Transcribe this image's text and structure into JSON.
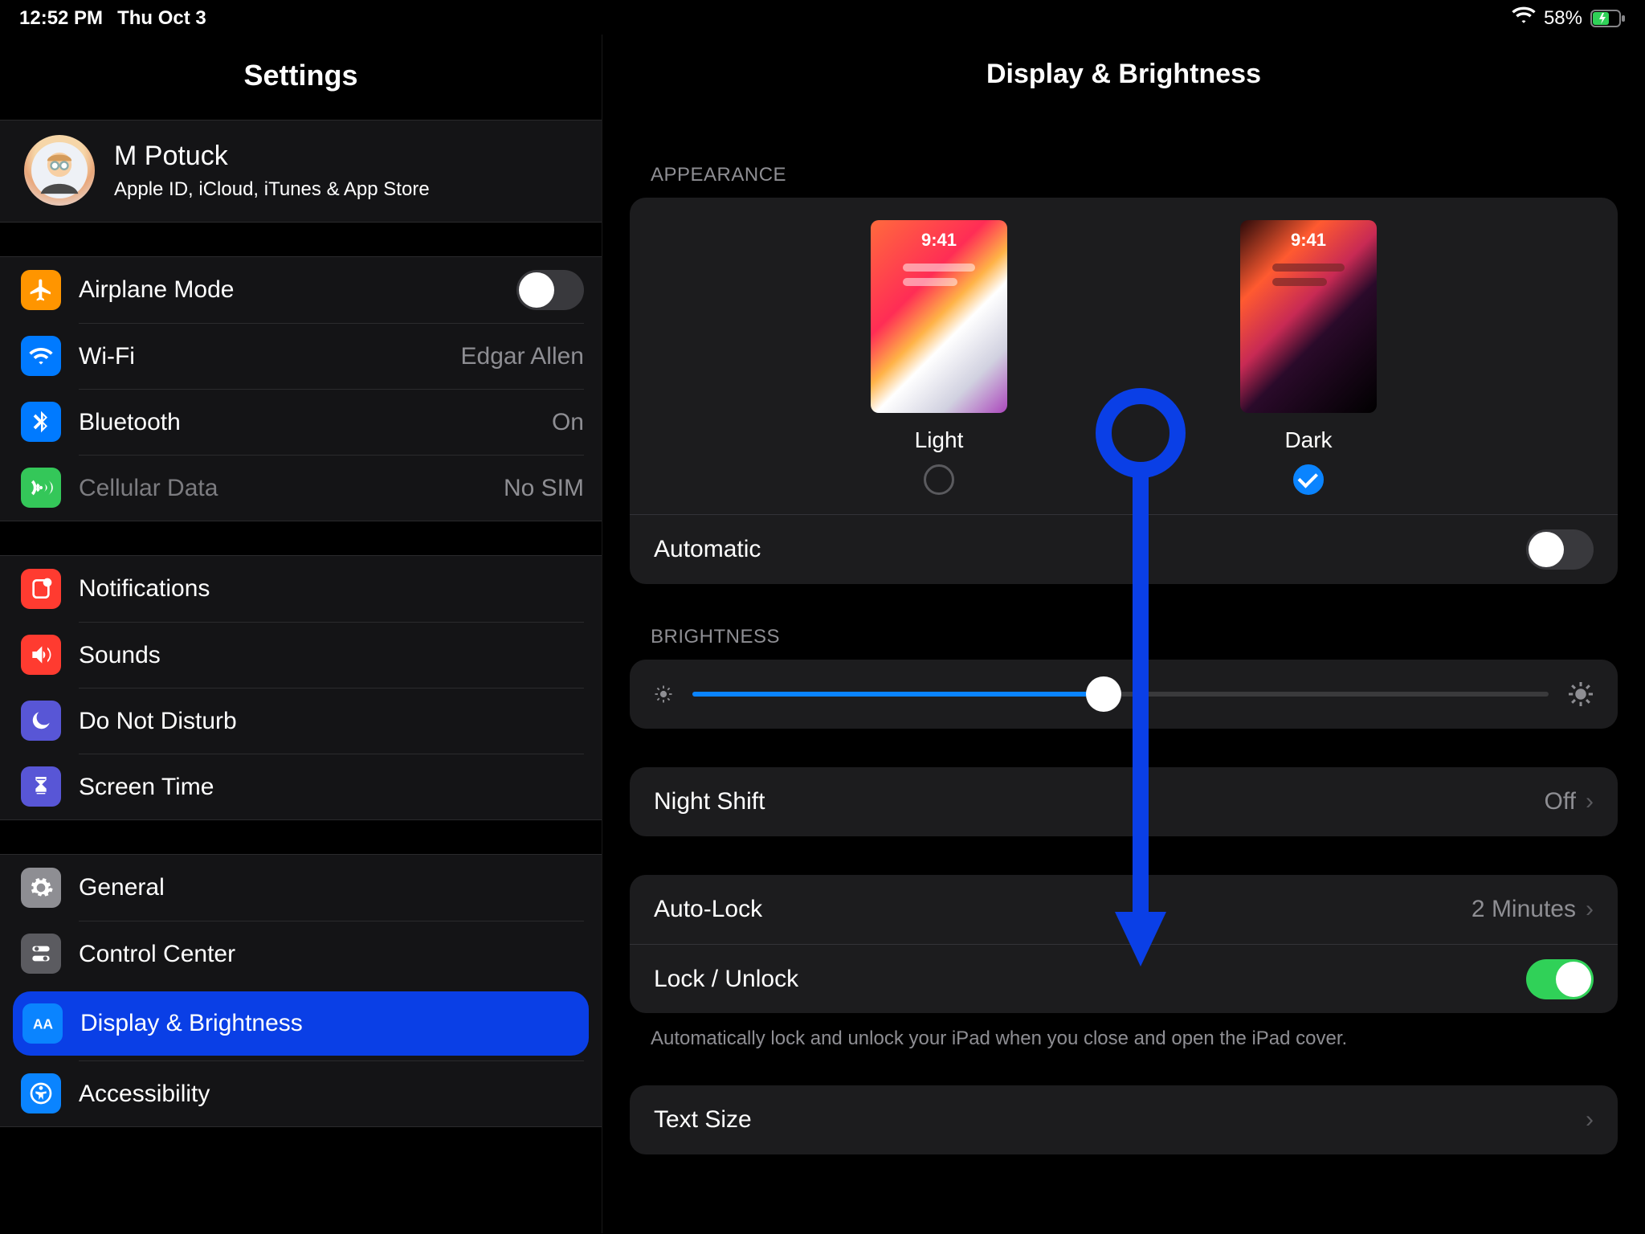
{
  "statusbar": {
    "time": "12:52 PM",
    "date": "Thu Oct 3",
    "battery_pct": "58%"
  },
  "sidebar": {
    "title": "Settings",
    "profile": {
      "name": "M Potuck",
      "sub": "Apple ID, iCloud, iTunes & App Store"
    },
    "group1": {
      "airplane": "Airplane Mode",
      "wifi": "Wi-Fi",
      "wifi_value": "Edgar Allen",
      "bluetooth": "Bluetooth",
      "bluetooth_value": "On",
      "cellular": "Cellular Data",
      "cellular_value": "No SIM"
    },
    "group2": {
      "notifications": "Notifications",
      "sounds": "Sounds",
      "dnd": "Do Not Disturb",
      "screentime": "Screen Time"
    },
    "group3": {
      "general": "General",
      "controlcenter": "Control Center",
      "display": "Display & Brightness",
      "accessibility": "Accessibility"
    }
  },
  "detail": {
    "title": "Display & Brightness",
    "appearance_header": "APPEARANCE",
    "light_label": "Light",
    "dark_label": "Dark",
    "preview_time": "9:41",
    "automatic": "Automatic",
    "brightness_header": "BRIGHTNESS",
    "night_shift": "Night Shift",
    "night_shift_value": "Off",
    "auto_lock": "Auto-Lock",
    "auto_lock_value": "2 Minutes",
    "lock_unlock": "Lock / Unlock",
    "lock_note": "Automatically lock and unlock your iPad when you close and open the iPad cover.",
    "text_size": "Text Size"
  }
}
